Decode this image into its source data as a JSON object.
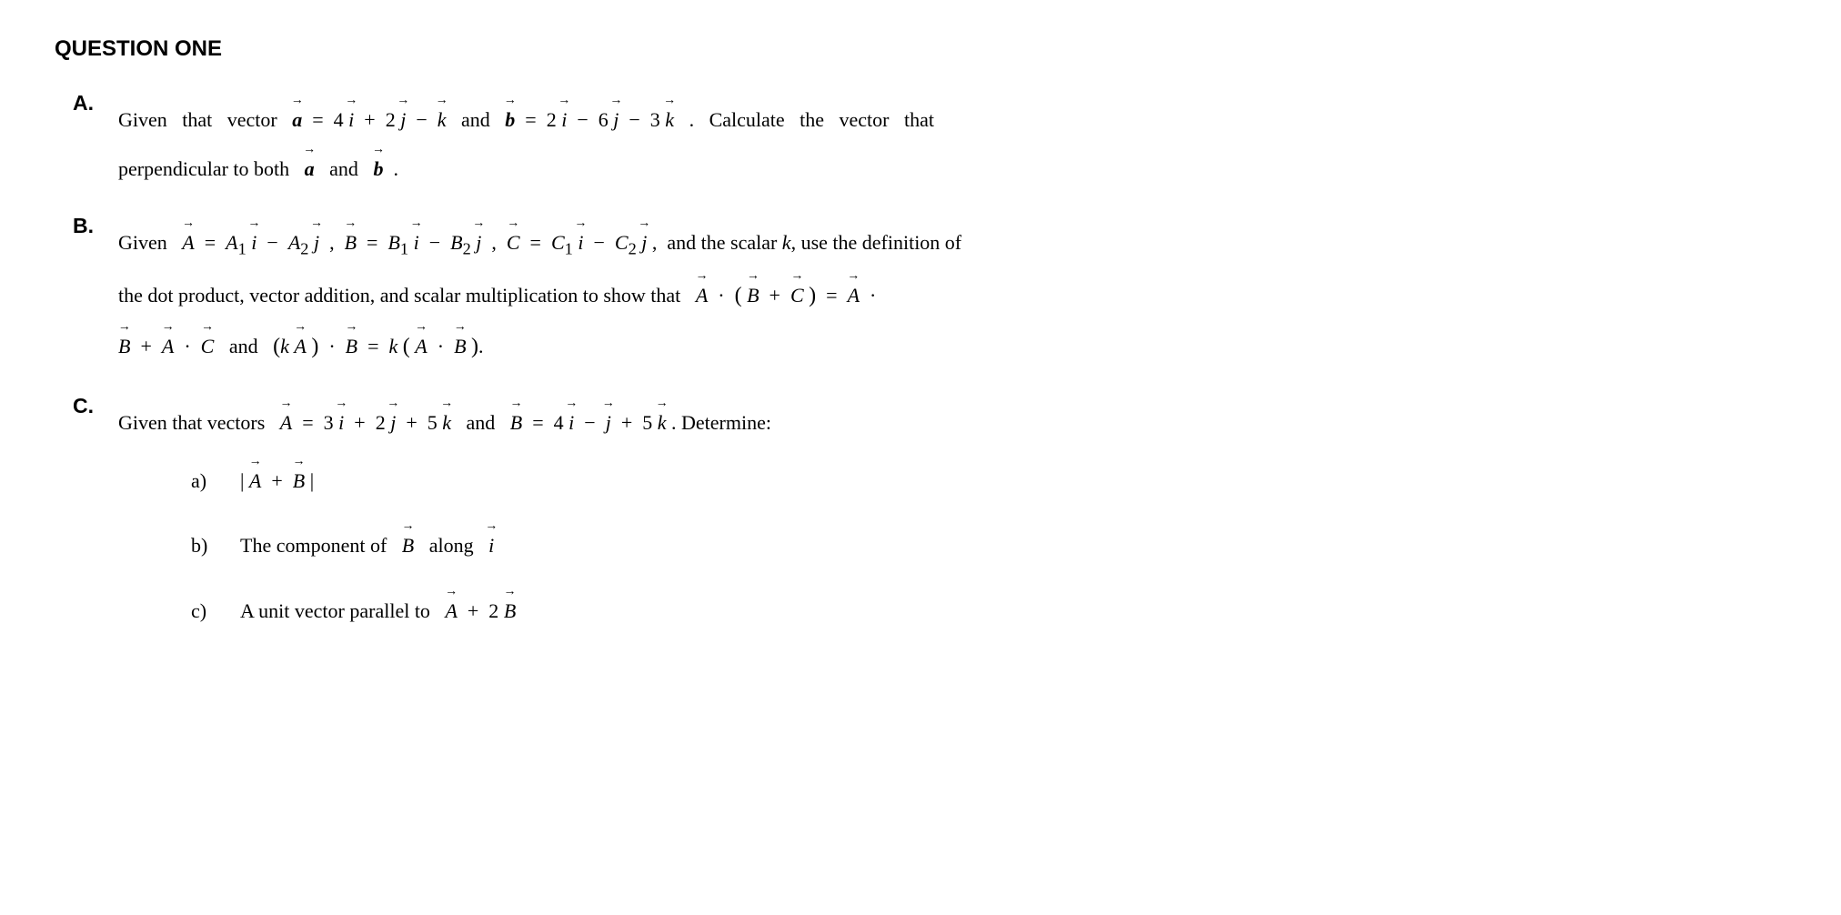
{
  "title": "QUESTION ONE",
  "parts": {
    "A": {
      "label": "A.",
      "text_line1": "Given  that  vector",
      "vec_a_def": "a⃗ = 4i⃗ + 2j⃗ − k⃗",
      "connector": "and",
      "vec_b_def": "b⃗ = 2i⃗ − 6j⃗ − 3k⃗",
      "text_line1b": ". Calculate  the  vector  that",
      "text_line2": "perpendicular to both",
      "vec_a": "a⃗",
      "and": "and",
      "vec_b": "b⃗",
      "period": "."
    },
    "B": {
      "label": "B.",
      "line1": "Given A⃗ = A₁i⃗ − A₂j⃗ , B⃗ = B₁i⃗ − B₂j⃗ , C⃗ = C₁i⃗ − C₂j⃗, and the scalar k, use the definition of",
      "line2": "the dot product, vector addition, and scalar multiplication to show that A⃗ · (B⃗ + C⃗) = A⃗ ·",
      "line3": "B⃗ + A⃗ · C⃗ and (kA⃗) · B⃗ = k(A⃗ · B⃗)."
    },
    "C": {
      "label": "C.",
      "intro": "Given that vectors",
      "vec_A_def": "A⃗ = 3i⃗ + 2j⃗ + 5k⃗",
      "and": "and",
      "vec_B_def": "B⃗ = 4i⃗ − j⃗ + 5k⃗",
      "determine": ". Determine:",
      "subs": [
        {
          "label": "a)",
          "text": "|A⃗ + B⃗|"
        },
        {
          "label": "b)",
          "text": "The component of B⃗ along i⃗"
        },
        {
          "label": "c)",
          "text": "A unit vector parallel to A⃗ + 2B⃗"
        }
      ]
    }
  }
}
